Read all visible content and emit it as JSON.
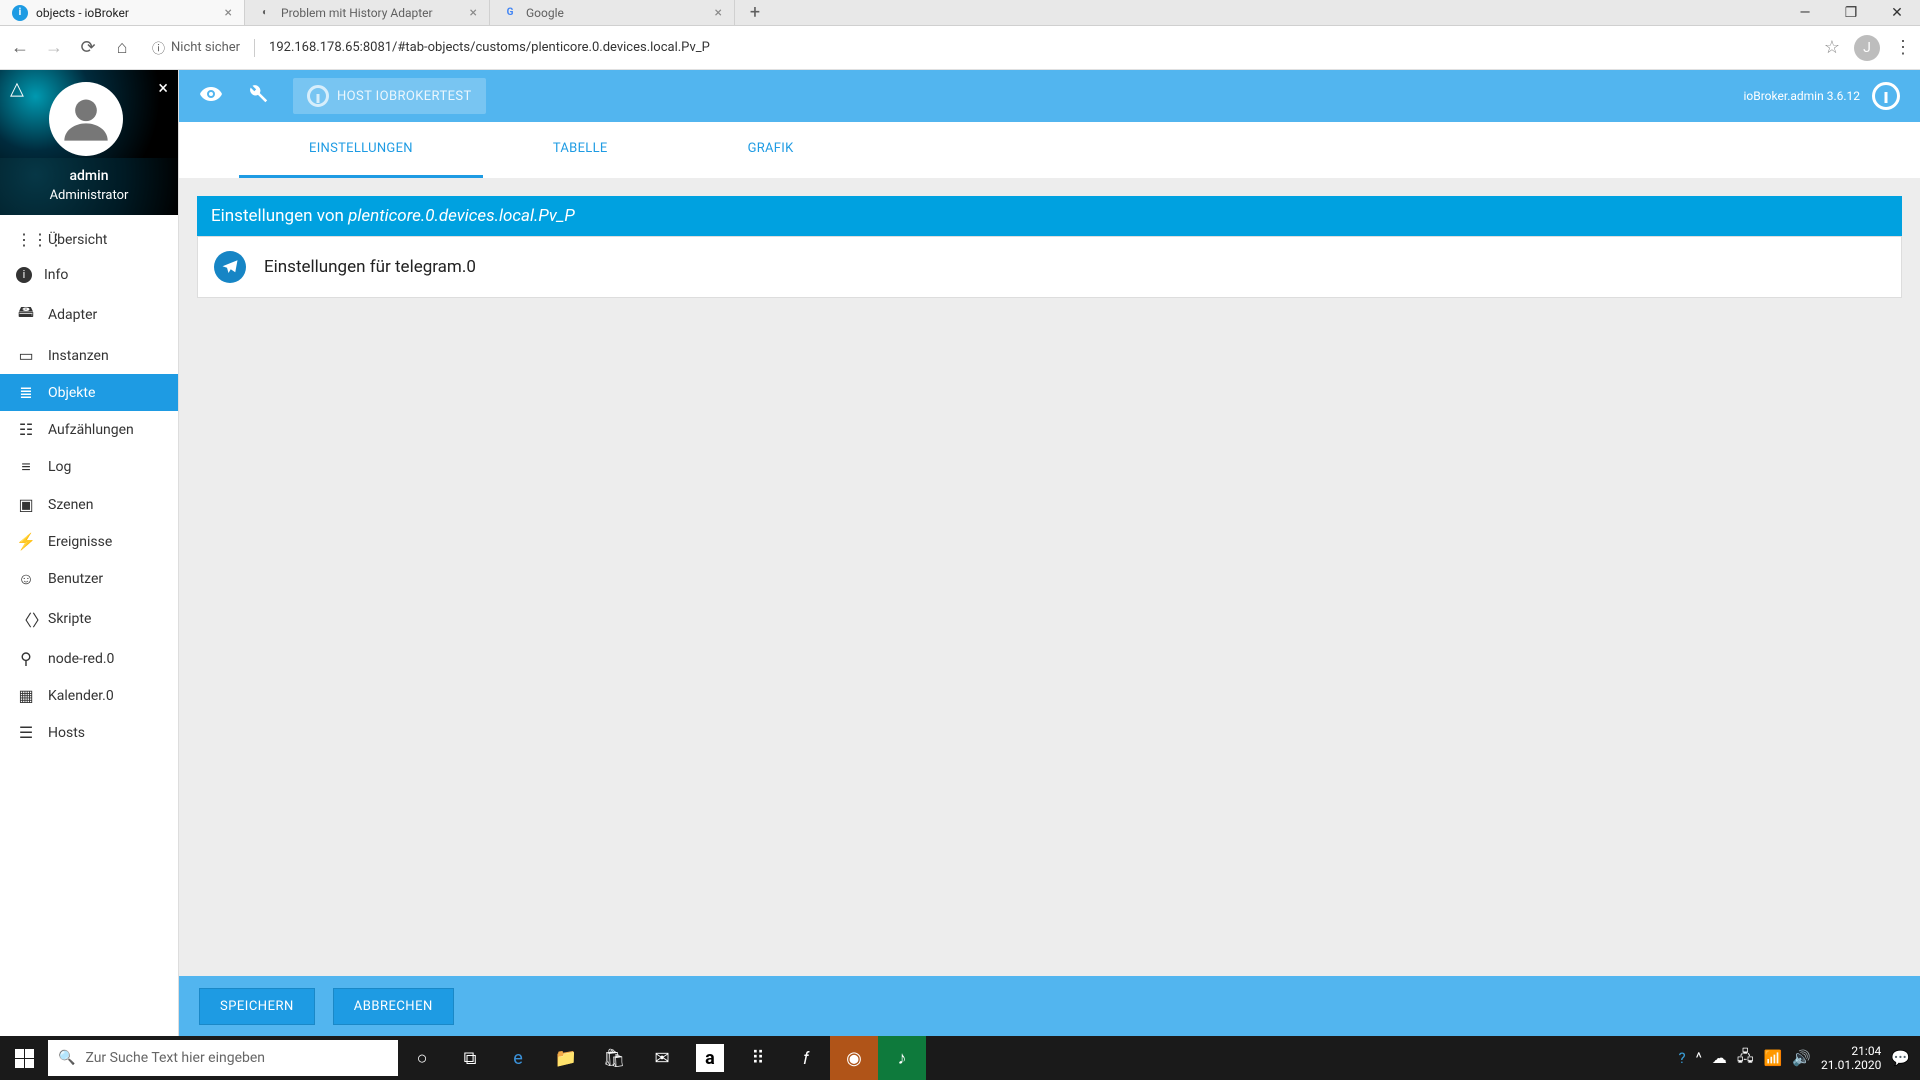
{
  "browser": {
    "tabs": [
      {
        "title": "objects - ioBroker",
        "active": true
      },
      {
        "title": "Problem mit History Adapter",
        "active": false
      },
      {
        "title": "Google",
        "active": false
      }
    ],
    "security_label": "Nicht sicher",
    "url": "192.168.178.65:8081/#tab-objects/customs/plenticore.0.devices.local.Pv_P",
    "user_letter": "J"
  },
  "sidebar": {
    "username": "admin",
    "role": "Administrator",
    "items": [
      {
        "label": "Übersicht",
        "icon": "⋮⋮⋮"
      },
      {
        "label": "Info",
        "icon": "ℹ"
      },
      {
        "label": "Adapter",
        "icon": "🖴"
      },
      {
        "label": "Instanzen",
        "icon": "▭"
      },
      {
        "label": "Objekte",
        "icon": "≣",
        "active": true
      },
      {
        "label": "Aufzählungen",
        "icon": "☰"
      },
      {
        "label": "Log",
        "icon": "≡"
      },
      {
        "label": "Szenen",
        "icon": "📷"
      },
      {
        "label": "Ereignisse",
        "icon": "⚡"
      },
      {
        "label": "Benutzer",
        "icon": "👤"
      },
      {
        "label": "Skripte",
        "icon": "〈〉"
      },
      {
        "label": "node-red.0",
        "icon": "⋔"
      },
      {
        "label": "Kalender.0",
        "icon": "📅"
      },
      {
        "label": "Hosts",
        "icon": "☰"
      }
    ]
  },
  "topbar": {
    "host_label": "HOST IOBROKERTEST",
    "version": "ioBroker.admin 3.6.12"
  },
  "subtabs": [
    "EINSTELLUNGEN",
    "TABELLE",
    "GRAFIK"
  ],
  "panel": {
    "header_prefix": "Einstellungen von ",
    "header_object": "plenticore.0.devices.local.Pv_P",
    "row_label": "Einstellungen für telegram.0"
  },
  "footer": {
    "save": "SPEICHERN",
    "cancel": "ABBRECHEN"
  },
  "taskbar": {
    "search_placeholder": "Zur Suche Text hier eingeben",
    "time": "21:04",
    "date": "21.01.2020"
  }
}
